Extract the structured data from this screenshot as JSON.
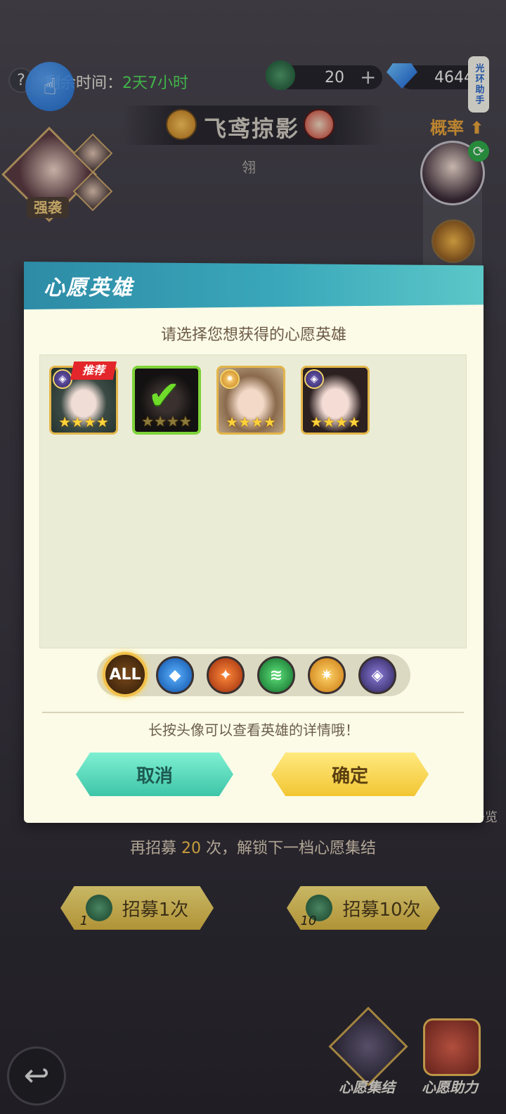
{
  "top": {
    "help_icon": "question-icon",
    "remaining_label": "剩余时间：",
    "remaining_value": "2天7小时",
    "frog_amount": "20",
    "gem_amount": "4644",
    "plus": "+",
    "assist_tab": "光环助手"
  },
  "banner": {
    "title": "飞鸢掠影",
    "sub_name": "翎",
    "probability": "概率"
  },
  "side": {
    "assault_label": "强袭"
  },
  "modal": {
    "title": "心愿英雄",
    "prompt": "请选择您想获得的心愿英雄",
    "recommend_tag": "推荐",
    "heroes": [
      {
        "stars": "★★★★",
        "selected": false
      },
      {
        "stars": "★★★★",
        "selected": true
      },
      {
        "stars": "★★★★",
        "selected": false
      },
      {
        "stars": "★★★★",
        "selected": false
      }
    ],
    "filters": [
      "ALL",
      "water",
      "fire",
      "wind",
      "light",
      "dark"
    ],
    "filter_all_label": "ALL",
    "tip": "长按头像可以查看英雄的详情哦！",
    "cancel_label": "取消",
    "confirm_label": "确定"
  },
  "bottom": {
    "unlock_prefix": "再招募 ",
    "unlock_count": "20",
    "unlock_suffix": " 次，解锁下一档心愿集结",
    "recruit1_label": "招募1次",
    "recruit1_cost": "1",
    "recruit10_label": "招募10次",
    "recruit10_cost": "10",
    "hero_list_label": "英雄一览",
    "wish_gather_label": "心愿集结",
    "wish_help_label": "心愿助力"
  },
  "colors": {
    "modal_header": "#3aa7ba",
    "cancel_button": "#4fd6b8",
    "confirm_button": "#f7d24a",
    "selected_border": "#7ed33a",
    "recommend_tag": "#e3262b"
  }
}
